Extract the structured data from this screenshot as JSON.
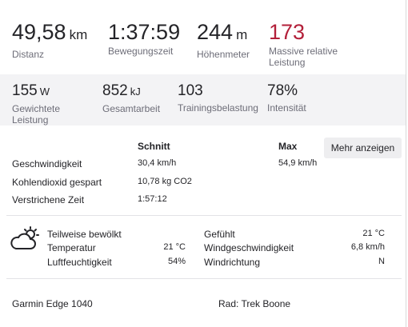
{
  "top_stats": [
    {
      "value": "49,58",
      "unit": "km",
      "label": "Distanz"
    },
    {
      "value": "1:37:59",
      "unit": "",
      "label": "Bewegungszeit"
    },
    {
      "value": "244",
      "unit": "m",
      "label": "Höhenmeter"
    },
    {
      "value": "173",
      "unit": "",
      "label": "Massive relative Leistung",
      "color": "#b3203a"
    }
  ],
  "band_stats": [
    {
      "value": "155",
      "unit": "W",
      "label": "Gewichtete Leistung"
    },
    {
      "value": "852",
      "unit": "kJ",
      "label": "Gesamtarbeit"
    },
    {
      "value": "103",
      "unit": "",
      "label": "Trainingsbelastung"
    },
    {
      "value": "78%",
      "unit": "",
      "label": "Intensität"
    }
  ],
  "details": {
    "header_avg": "Schnitt",
    "header_max": "Max",
    "more_button": "Mehr anzeigen",
    "rows": [
      {
        "label": "Geschwindigkeit",
        "avg": "30,4 km/h",
        "max": "54,9 km/h"
      },
      {
        "label": "Kohlendioxid gespart",
        "avg": "10,78 kg CO2",
        "max": ""
      },
      {
        "label": "Verstrichene Zeit",
        "avg": "1:57:12",
        "max": ""
      }
    ]
  },
  "weather": {
    "icon": "partly-cloudy-icon",
    "condition": "Teilweise bewölkt",
    "left": [
      {
        "label": "Temperatur",
        "value": "21 °C"
      },
      {
        "label": "Luftfeuchtigkeit",
        "value": "54%"
      }
    ],
    "right": [
      {
        "label": "Gefühlt",
        "value": "21 °C"
      },
      {
        "label": "Windgeschwindigkeit",
        "value": "6,8 km/h"
      },
      {
        "label": "Windrichtung",
        "value": "N"
      }
    ]
  },
  "footer": {
    "device": "Garmin Edge 1040",
    "bike": "Rad: Trek Boone"
  }
}
